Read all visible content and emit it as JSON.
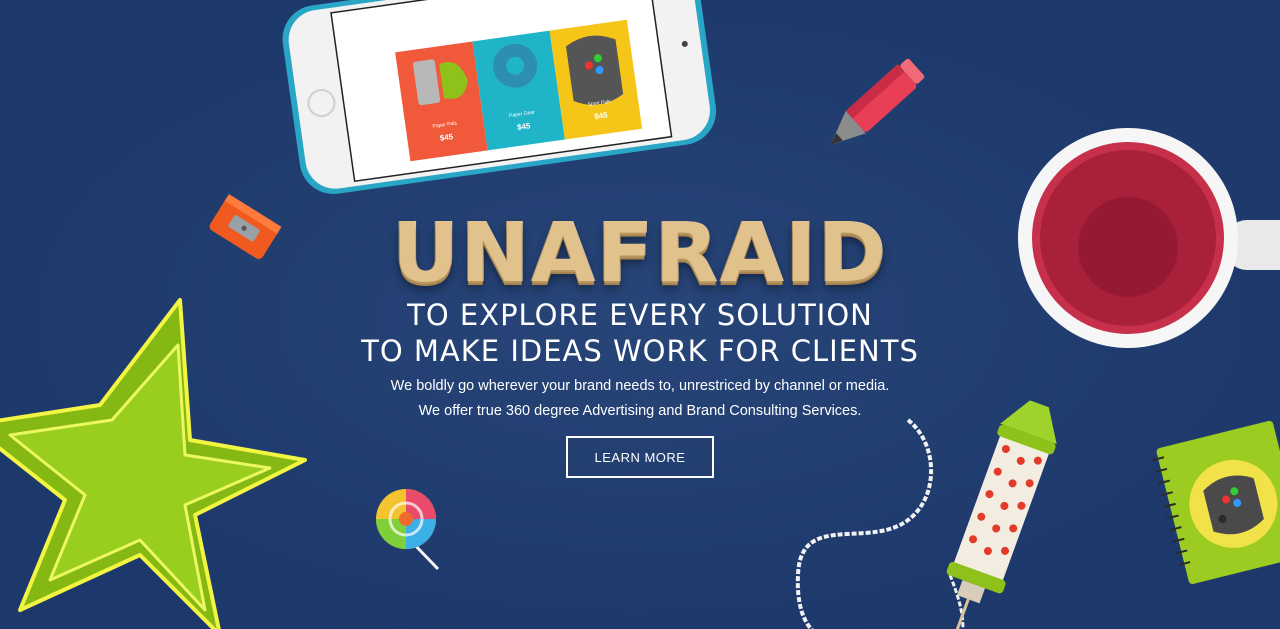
{
  "hero": {
    "headline": "UNAFRAID",
    "subheading_line1": "TO EXPLORE EVERY SOLUTION",
    "subheading_line2": "TO MAKE IDEAS WORK FOR CLIENTS",
    "description_line1": "We boldly go wherever your brand needs to, unrestriced by channel or media.",
    "description_line2": "We offer true 360 degree Advertising and Brand Consulting Services.",
    "cta_label": "LEARN MORE"
  },
  "phone_screen": {
    "products": [
      {
        "name": "Paper Pals",
        "price": "$45",
        "color": "#f05a3a"
      },
      {
        "name": "Paper Gear",
        "price": "$45",
        "color": "#20b4c8"
      },
      {
        "name": "Sport Pals",
        "price": "$45",
        "color": "#f5c518"
      }
    ]
  },
  "colors": {
    "background": "#1f3d73",
    "headline": "#e1c28d",
    "star": "#8ec21a",
    "mug_tea": "#c6304a"
  },
  "icons": [
    "phone-illustration",
    "pencil-icon",
    "sharpener-icon",
    "star-tray-icon",
    "lollipop-icon",
    "mug-icon",
    "firework-rocket-icon",
    "notebook-icon"
  ]
}
